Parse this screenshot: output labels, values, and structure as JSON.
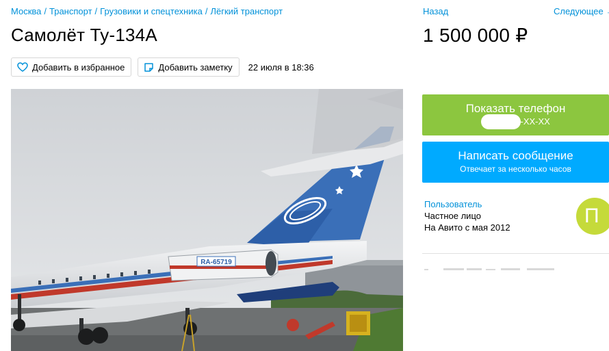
{
  "breadcrumb": {
    "items": [
      "Москва",
      "Транспорт",
      "Грузовики и спецтехника",
      "Лёгкий транспорт"
    ],
    "separator": "/"
  },
  "listing": {
    "title": "Самолёт Ту-134А",
    "date": "22 июля в 18:36",
    "favorite_label": "Добавить в избранное",
    "note_label": "Добавить заметку",
    "registration": "RA-65719"
  },
  "nav": {
    "back_label": "Назад",
    "next_label": "Следующее →"
  },
  "price": "1 500 000 ₽",
  "phone_button": {
    "label": "Показать телефон",
    "masked_number": "XX-XX-XX",
    "color": "#8cc63f"
  },
  "message_button": {
    "label": "Написать сообщение",
    "sublabel": "Отвечает за несколько часов",
    "color": "#00aaff"
  },
  "seller": {
    "name": "Пользователь",
    "type": "Частное лицо",
    "since": "На Авито с мая 2012",
    "avatar_letter": "П",
    "avatar_color": "#c5da3a"
  },
  "colors": {
    "link": "#0091d9"
  }
}
